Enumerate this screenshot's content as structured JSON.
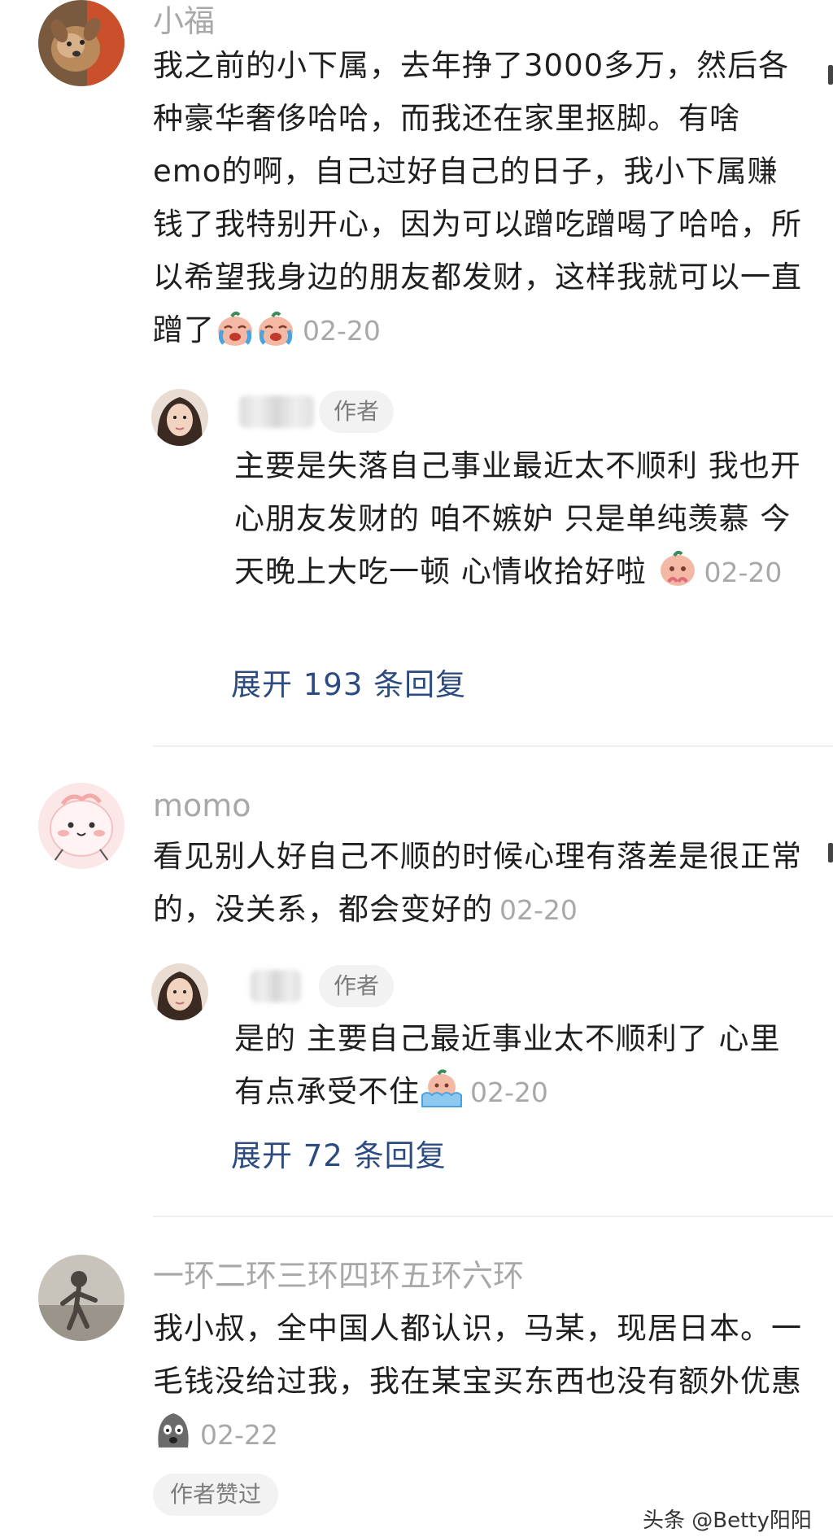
{
  "comments": [
    {
      "username": "小福",
      "text": "我之前的小下属，去年挣了3000多万，然后各种豪华奢侈哈哈，而我还在家里抠脚。有啥emo的啊，自己过好自己的日子，我小下属赚钱了我特别开心，因为可以蹭吃蹭喝了哈哈，所以希望我身边的朋友都发财，这样我就可以一直蹭了",
      "emojis": [
        "crying-face-emoji",
        "crying-face-emoji"
      ],
      "date": "02-20",
      "reply": {
        "badge": "作者",
        "text": "主要是失落自己事业最近太不顺利 我也开心朋友发财的 咱不嫉妒 只是单纯羡慕 今天晚上大吃一顿 心情收拾好啦",
        "emoji": "pleading-face-emoji",
        "date": "02-20"
      },
      "expand_label": "展开 193 条回复"
    },
    {
      "username": "momo",
      "text": "看见别人好自己不顺的时候心理有落差是很正常的，没关系，都会变好的",
      "date": "02-20",
      "reply": {
        "badge": "作者",
        "text": "是的 主要自己最近事业太不顺利了 心里有点承受不住",
        "emoji": "crying-in-bath-emoji",
        "date": "02-20"
      },
      "expand_label": "展开 72 条回复"
    },
    {
      "username": "一环二环三环四环五环六环",
      "text": "我小叔，全中国人都认识，马某，现居日本。一毛钱没给过我，我在某宝买东西也没有额外优惠",
      "emoji": "speechless-face-emoji",
      "date": "02-22",
      "liked_label": "作者赞过"
    }
  ],
  "watermark": "头条 @Betty阳阳",
  "colors": {
    "text": "#1f1f1f",
    "meta": "#a8a8a8",
    "link": "#2c4b80",
    "chip_bg": "#f2f2f2",
    "divider": "#efefef"
  }
}
